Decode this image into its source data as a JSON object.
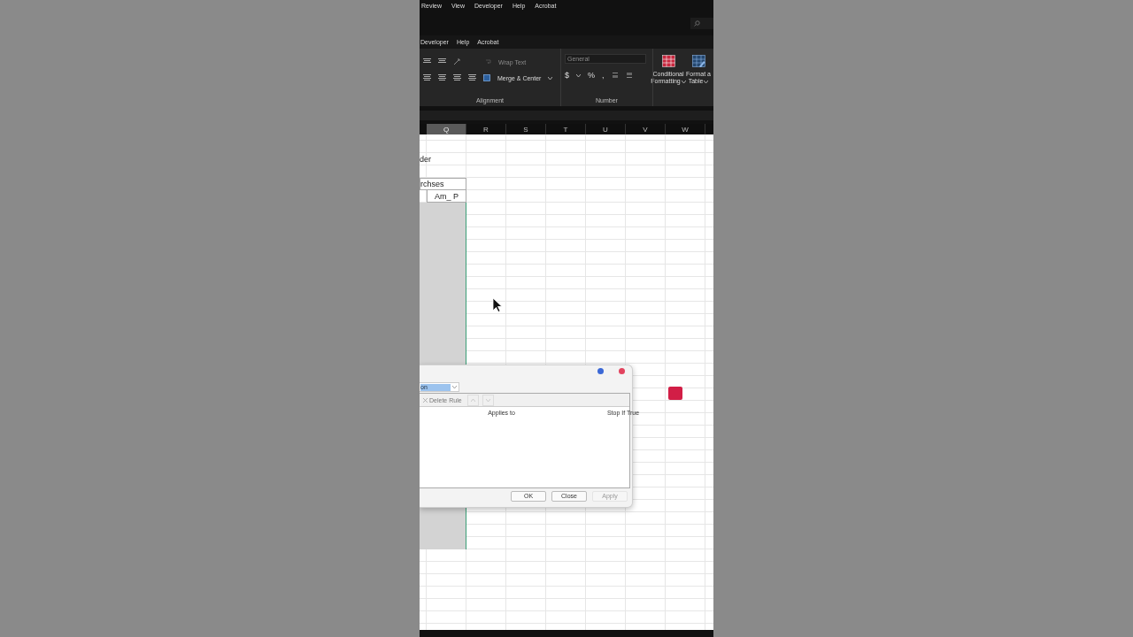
{
  "menu_tabs": [
    "Review",
    "View",
    "Developer",
    "Help",
    "Acrobat"
  ],
  "ribbon_tabs": [
    "Developer",
    "Help",
    "Acrobat"
  ],
  "ribbon": {
    "alignment": {
      "wrap_text": "Wrap Text",
      "merge_center": "Merge & Center",
      "label": "Alignment"
    },
    "number": {
      "format": "General",
      "currency": "$",
      "percent": "%",
      "comma": ",",
      "label": "Number"
    },
    "styles": [
      {
        "lines": [
          "Conditional",
          "Formatting"
        ],
        "kind": "conditional"
      },
      {
        "lines": [
          "Format a",
          "Table"
        ],
        "kind": "table"
      }
    ]
  },
  "columns": [
    {
      "label": "Q",
      "selected": true
    },
    {
      "label": "R",
      "selected": false
    },
    {
      "label": "S",
      "selected": false
    },
    {
      "label": "T",
      "selected": false
    },
    {
      "label": "U",
      "selected": false
    },
    {
      "label": "V",
      "selected": false
    },
    {
      "label": "W",
      "selected": false
    }
  ],
  "sheet": {
    "title_fragment": "der",
    "header_fragment": "rchses",
    "column_header": "Am_ P"
  },
  "dialog": {
    "controls": [
      {
        "color": "#3b68d6"
      },
      {
        "color": "#e2435e"
      }
    ],
    "scope_field": "on",
    "toolbar": [
      "Delete Rule"
    ],
    "list_columns": [
      "Applies to",
      "Stop If True"
    ],
    "buttons": [
      {
        "label": "OK",
        "disabled": false
      },
      {
        "label": "Close",
        "disabled": false
      },
      {
        "label": "Apply",
        "disabled": true
      }
    ]
  }
}
